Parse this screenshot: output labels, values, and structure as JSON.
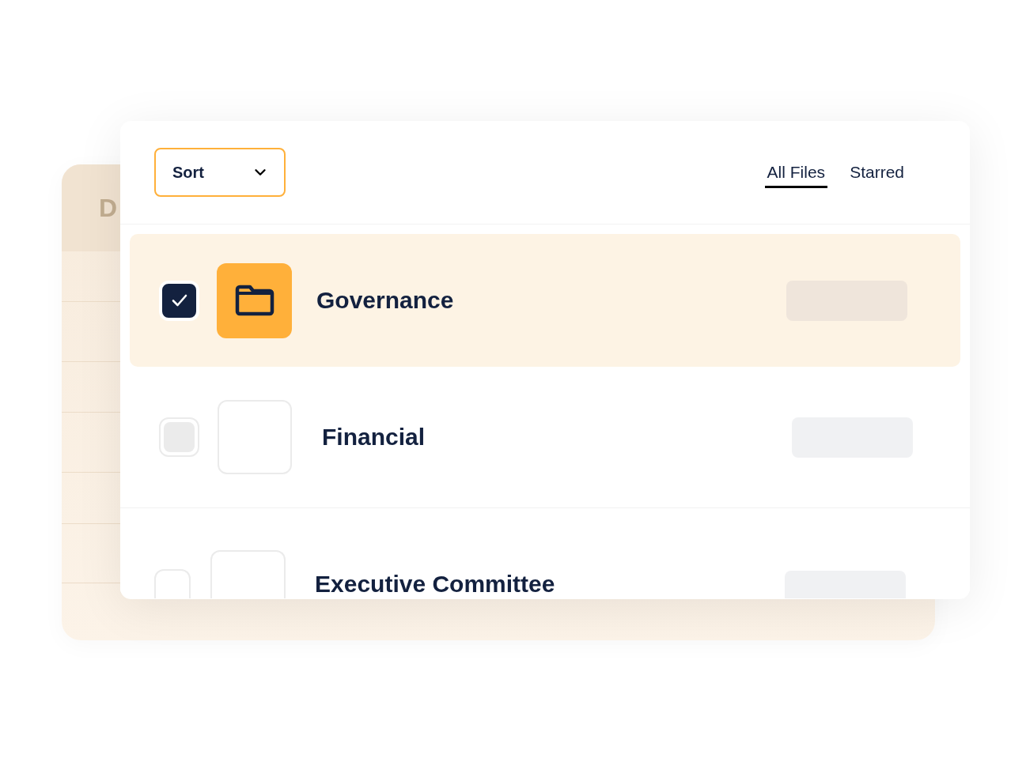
{
  "background_card": {
    "header": "D"
  },
  "toolbar": {
    "sort": "Sort",
    "tabs": [
      {
        "label": "All Files",
        "selected": true
      },
      {
        "label": "Starred",
        "selected": false
      }
    ]
  },
  "rows": [
    {
      "name": "Governance",
      "selected": true,
      "checked": true
    },
    {
      "name": "Financial",
      "selected": false,
      "checked": false
    },
    {
      "name": "Executive Committee",
      "selected": false,
      "checked": false
    }
  ]
}
